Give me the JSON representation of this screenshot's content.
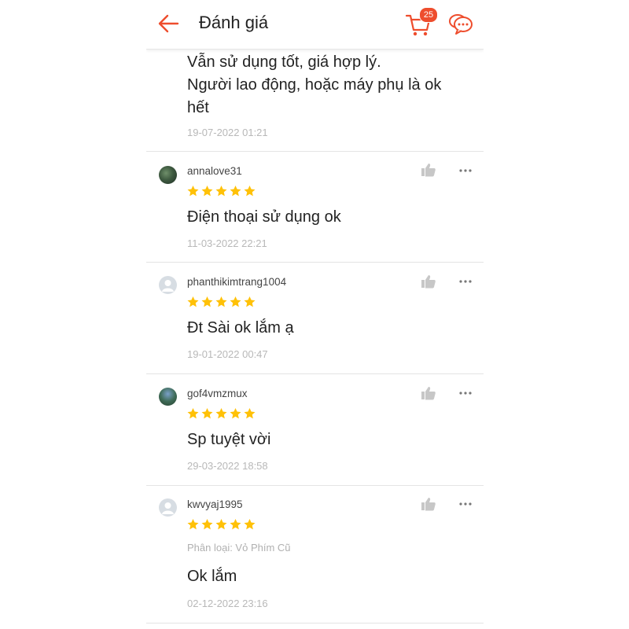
{
  "header": {
    "title": "Đánh giá",
    "cart_count": "25",
    "accent": "#ee4d2d"
  },
  "partial_review": {
    "comment": "Vẫn sử dụng tốt, giá hợp lý.\nNgười lao động, hoặc máy phụ là ok\nhết",
    "date": "19-07-2022 01:21"
  },
  "reviews": [
    {
      "username": "annalove31",
      "rating": 5,
      "comment": "Điện thoại sử dụng ok",
      "date": "11-03-2022 22:21",
      "avatar": "photo"
    },
    {
      "username": "phanthikimtrang1004",
      "rating": 5,
      "comment": "Đt Sài ok lắm ạ",
      "date": "19-01-2022 00:47",
      "avatar": "default"
    },
    {
      "username": "gof4vmzmux",
      "rating": 5,
      "comment": "Sp tuyệt vời",
      "date": "29-03-2022 18:58",
      "avatar": "photo"
    },
    {
      "username": "kwvyaj1995",
      "rating": 5,
      "variant": "Phân loại: Vỏ Phím Cũ",
      "comment": "Ok lắm",
      "date": "02-12-2022 23:16",
      "avatar": "default"
    }
  ],
  "colors": {
    "star": "#ffc107",
    "text": "#222222",
    "muted": "#b8b8b8",
    "divider": "#e4e4e4"
  },
  "icons": [
    "back-arrow-icon",
    "cart-icon",
    "chat-icon",
    "thumbs-up-icon",
    "more-dots-icon",
    "star-icon",
    "default-avatar-icon"
  ]
}
